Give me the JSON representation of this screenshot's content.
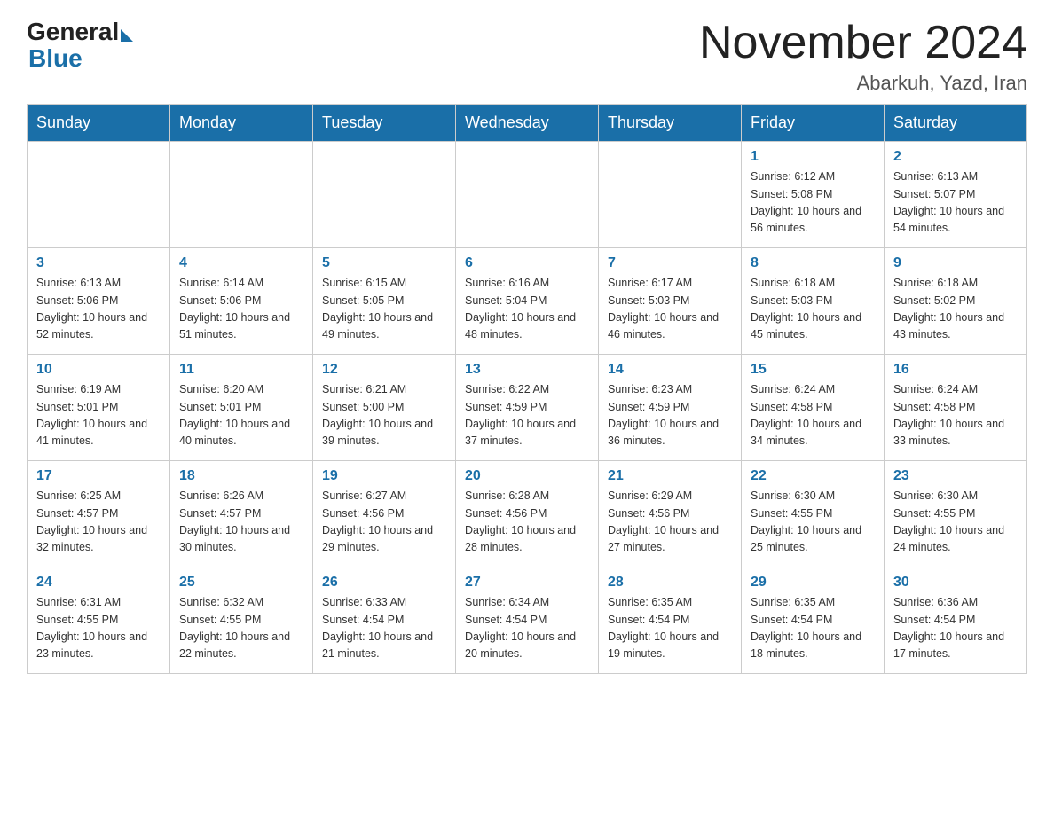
{
  "logo": {
    "general": "General",
    "blue": "Blue"
  },
  "header": {
    "month_title": "November 2024",
    "location": "Abarkuh, Yazd, Iran"
  },
  "weekdays": [
    "Sunday",
    "Monday",
    "Tuesday",
    "Wednesday",
    "Thursday",
    "Friday",
    "Saturday"
  ],
  "weeks": [
    [
      {
        "day": "",
        "info": ""
      },
      {
        "day": "",
        "info": ""
      },
      {
        "day": "",
        "info": ""
      },
      {
        "day": "",
        "info": ""
      },
      {
        "day": "",
        "info": ""
      },
      {
        "day": "1",
        "info": "Sunrise: 6:12 AM\nSunset: 5:08 PM\nDaylight: 10 hours and 56 minutes."
      },
      {
        "day": "2",
        "info": "Sunrise: 6:13 AM\nSunset: 5:07 PM\nDaylight: 10 hours and 54 minutes."
      }
    ],
    [
      {
        "day": "3",
        "info": "Sunrise: 6:13 AM\nSunset: 5:06 PM\nDaylight: 10 hours and 52 minutes."
      },
      {
        "day": "4",
        "info": "Sunrise: 6:14 AM\nSunset: 5:06 PM\nDaylight: 10 hours and 51 minutes."
      },
      {
        "day": "5",
        "info": "Sunrise: 6:15 AM\nSunset: 5:05 PM\nDaylight: 10 hours and 49 minutes."
      },
      {
        "day": "6",
        "info": "Sunrise: 6:16 AM\nSunset: 5:04 PM\nDaylight: 10 hours and 48 minutes."
      },
      {
        "day": "7",
        "info": "Sunrise: 6:17 AM\nSunset: 5:03 PM\nDaylight: 10 hours and 46 minutes."
      },
      {
        "day": "8",
        "info": "Sunrise: 6:18 AM\nSunset: 5:03 PM\nDaylight: 10 hours and 45 minutes."
      },
      {
        "day": "9",
        "info": "Sunrise: 6:18 AM\nSunset: 5:02 PM\nDaylight: 10 hours and 43 minutes."
      }
    ],
    [
      {
        "day": "10",
        "info": "Sunrise: 6:19 AM\nSunset: 5:01 PM\nDaylight: 10 hours and 41 minutes."
      },
      {
        "day": "11",
        "info": "Sunrise: 6:20 AM\nSunset: 5:01 PM\nDaylight: 10 hours and 40 minutes."
      },
      {
        "day": "12",
        "info": "Sunrise: 6:21 AM\nSunset: 5:00 PM\nDaylight: 10 hours and 39 minutes."
      },
      {
        "day": "13",
        "info": "Sunrise: 6:22 AM\nSunset: 4:59 PM\nDaylight: 10 hours and 37 minutes."
      },
      {
        "day": "14",
        "info": "Sunrise: 6:23 AM\nSunset: 4:59 PM\nDaylight: 10 hours and 36 minutes."
      },
      {
        "day": "15",
        "info": "Sunrise: 6:24 AM\nSunset: 4:58 PM\nDaylight: 10 hours and 34 minutes."
      },
      {
        "day": "16",
        "info": "Sunrise: 6:24 AM\nSunset: 4:58 PM\nDaylight: 10 hours and 33 minutes."
      }
    ],
    [
      {
        "day": "17",
        "info": "Sunrise: 6:25 AM\nSunset: 4:57 PM\nDaylight: 10 hours and 32 minutes."
      },
      {
        "day": "18",
        "info": "Sunrise: 6:26 AM\nSunset: 4:57 PM\nDaylight: 10 hours and 30 minutes."
      },
      {
        "day": "19",
        "info": "Sunrise: 6:27 AM\nSunset: 4:56 PM\nDaylight: 10 hours and 29 minutes."
      },
      {
        "day": "20",
        "info": "Sunrise: 6:28 AM\nSunset: 4:56 PM\nDaylight: 10 hours and 28 minutes."
      },
      {
        "day": "21",
        "info": "Sunrise: 6:29 AM\nSunset: 4:56 PM\nDaylight: 10 hours and 27 minutes."
      },
      {
        "day": "22",
        "info": "Sunrise: 6:30 AM\nSunset: 4:55 PM\nDaylight: 10 hours and 25 minutes."
      },
      {
        "day": "23",
        "info": "Sunrise: 6:30 AM\nSunset: 4:55 PM\nDaylight: 10 hours and 24 minutes."
      }
    ],
    [
      {
        "day": "24",
        "info": "Sunrise: 6:31 AM\nSunset: 4:55 PM\nDaylight: 10 hours and 23 minutes."
      },
      {
        "day": "25",
        "info": "Sunrise: 6:32 AM\nSunset: 4:55 PM\nDaylight: 10 hours and 22 minutes."
      },
      {
        "day": "26",
        "info": "Sunrise: 6:33 AM\nSunset: 4:54 PM\nDaylight: 10 hours and 21 minutes."
      },
      {
        "day": "27",
        "info": "Sunrise: 6:34 AM\nSunset: 4:54 PM\nDaylight: 10 hours and 20 minutes."
      },
      {
        "day": "28",
        "info": "Sunrise: 6:35 AM\nSunset: 4:54 PM\nDaylight: 10 hours and 19 minutes."
      },
      {
        "day": "29",
        "info": "Sunrise: 6:35 AM\nSunset: 4:54 PM\nDaylight: 10 hours and 18 minutes."
      },
      {
        "day": "30",
        "info": "Sunrise: 6:36 AM\nSunset: 4:54 PM\nDaylight: 10 hours and 17 minutes."
      }
    ]
  ]
}
